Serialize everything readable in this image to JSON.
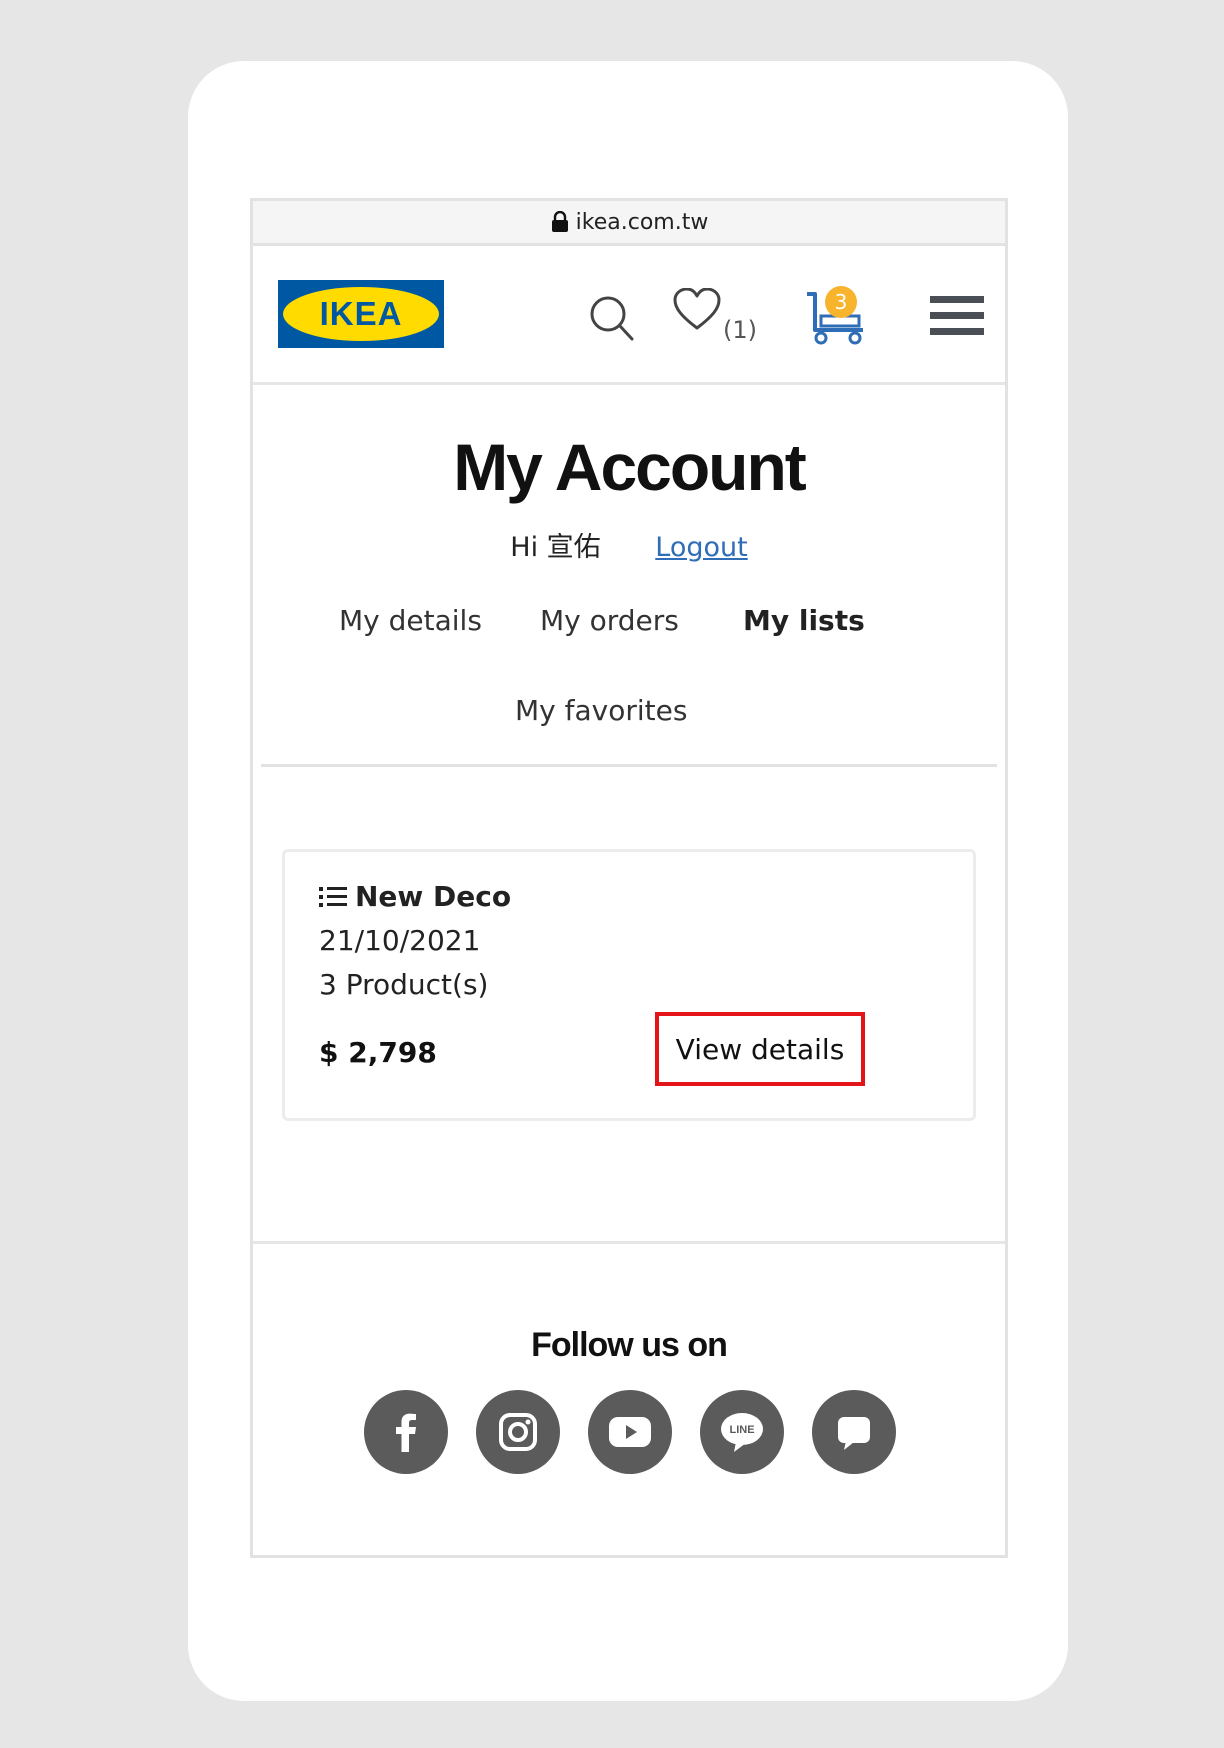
{
  "browser": {
    "url": "ikea.com.tw"
  },
  "header": {
    "logo_text": "IKEA",
    "wishlist_count": "(1)",
    "cart_count": "3"
  },
  "page": {
    "title": "My Account",
    "greeting": "Hi 宣佑",
    "logout_label": "Logout"
  },
  "tabs": [
    {
      "label": "My details",
      "active": false
    },
    {
      "label": "My orders",
      "active": false
    },
    {
      "label": "My lists",
      "active": true
    },
    {
      "label": "My favorites",
      "active": false
    }
  ],
  "list_card": {
    "name": "New Deco",
    "date": "21/10/2021",
    "product_count": "3 Product(s)",
    "price": "$ 2,798",
    "view_details_label": "View details",
    "highlight_color": "#e4141b"
  },
  "footer": {
    "follow_label": "Follow us on",
    "social_icons": [
      "facebook-icon",
      "instagram-icon",
      "youtube-icon",
      "line-icon",
      "chat-icon"
    ]
  },
  "colors": {
    "ikea_blue": "#0058a3",
    "ikea_yellow": "#ffdb00",
    "link": "#2f6db6",
    "badge": "#f7b42c",
    "social_bg": "#5b5b5b"
  }
}
